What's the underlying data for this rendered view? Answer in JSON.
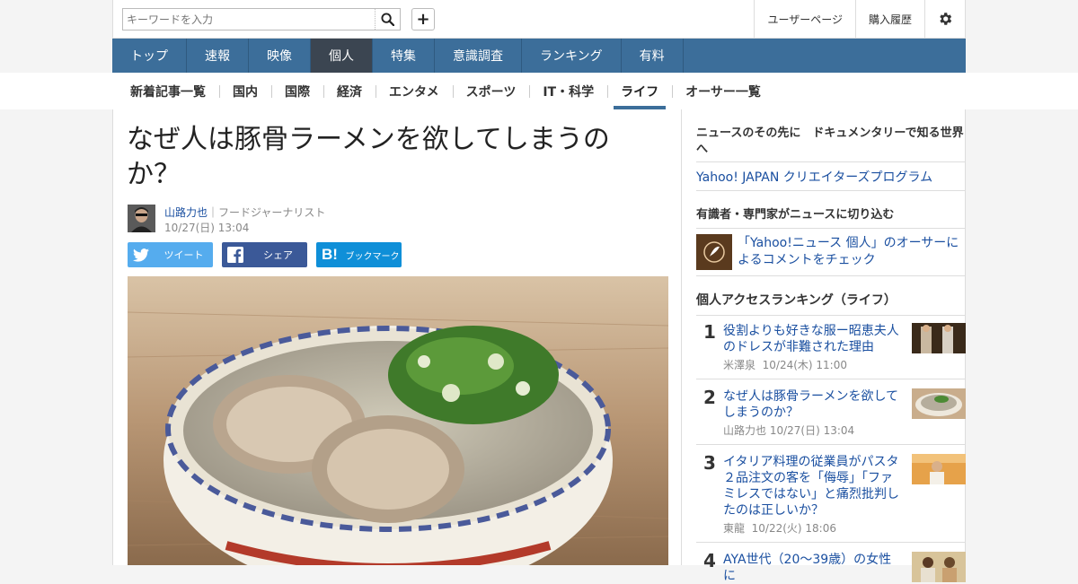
{
  "header": {
    "search_placeholder": "キーワードを入力",
    "plus_label": "+",
    "links": [
      "ユーザーページ",
      "購入履歴"
    ]
  },
  "mainnav": [
    "トップ",
    "速報",
    "映像",
    "個人",
    "特集",
    "意識調査",
    "ランキング",
    "有料"
  ],
  "mainnav_active": "個人",
  "subnav": [
    "新着記事一覧",
    "国内",
    "国際",
    "経済",
    "エンタメ",
    "スポーツ",
    "IT・科学",
    "ライフ",
    "オーサー一覧"
  ],
  "subnav_active": "ライフ",
  "article": {
    "title": "なぜ人は豚骨ラーメンを欲してしまうのか？",
    "author": "山路力也",
    "author_role": "｜フードジャーナリスト",
    "date": "10/27(日) 13:04",
    "share": {
      "twitter": "ツイート",
      "facebook": "シェア",
      "hatena": "ブックマーク"
    }
  },
  "sidebar": {
    "section1_heading": "ニュースのその先に　ドキュメンタリーで知る世界へ",
    "section1_link": "Yahoo! JAPAN クリエイターズプログラム",
    "section2_heading": "有識者・専門家がニュースに切り込む",
    "section2_link": "「Yahoo!ニュース 個人」のオーサーによるコメントをチェック",
    "ranking_heading": "個人アクセスランキング（ライフ）",
    "ranking": [
      {
        "rank": "1",
        "title": "役割よりも好きな服ー昭恵夫人のドレスが非難された理由",
        "author": "米澤泉",
        "date": "10/24(木) 11:00"
      },
      {
        "rank": "2",
        "title": "なぜ人は豚骨ラーメンを欲してしまうのか？",
        "author": "山路力也",
        "date": "10/27(日) 13:04"
      },
      {
        "rank": "3",
        "title": "イタリア料理の従業員がパスタ２品注文の客を「侮辱」「ファミレスではない」と痛烈批判したのは正しいか？",
        "author": "東龍",
        "date": "10/22(火) 18:06"
      },
      {
        "rank": "4",
        "title": "AYA世代（20〜39歳）の女性に",
        "author": "",
        "date": ""
      }
    ]
  },
  "colors": {
    "nav": "#3c6e9a",
    "nav_active": "#3b4551",
    "link": "#1a4fa0",
    "twitter": "#55acee",
    "facebook": "#3b5998",
    "hatena": "#0f8fd8"
  }
}
